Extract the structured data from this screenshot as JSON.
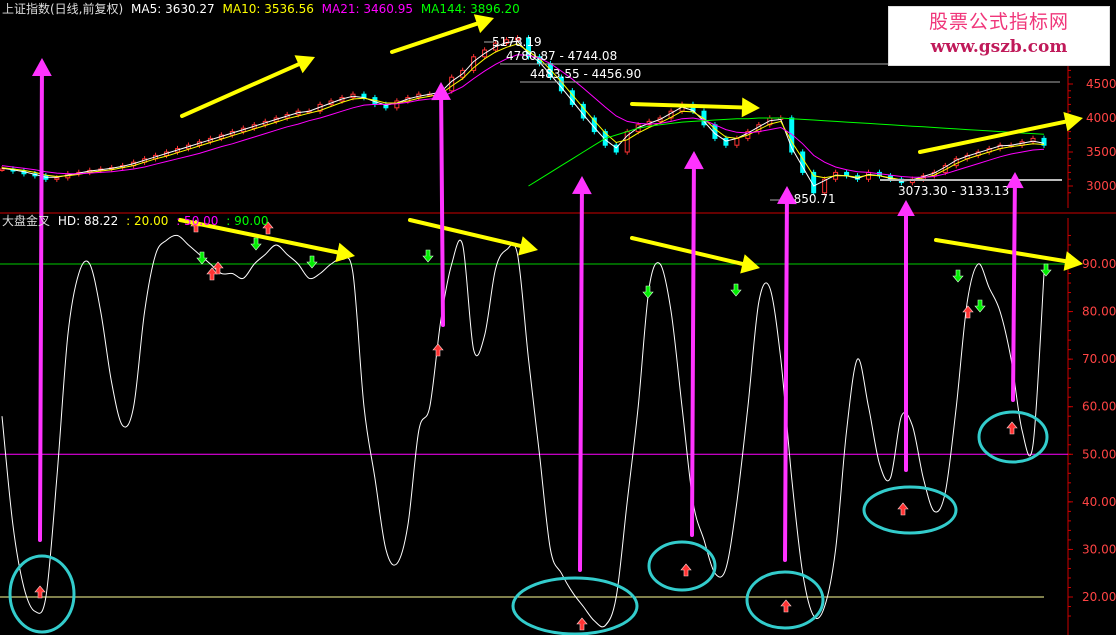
{
  "header": {
    "title": "上证指数(日线,前复权)",
    "ma5": "MA5: 3630.27",
    "ma10": "MA10: 3536.56",
    "ma21": "MA21: 3460.95",
    "ma144": "MA144: 3896.20"
  },
  "lower_header": {
    "name": "大盘金叉",
    "hd": "HD: 88.22",
    "l1": ": 20.00",
    "l2": ": 50.00",
    "l3": ": 90.00"
  },
  "watermark": {
    "line1": "股票公式指标网",
    "line2": "www.gszb.com"
  },
  "colors": {
    "ma5": "#ffffff",
    "ma10": "#ffff00",
    "ma21": "#ff00ff",
    "ma144": "#00ff00",
    "up": "#ff3333",
    "down": "#00ffff",
    "axis": "#cc0000",
    "arrow_yellow": "#ffff00",
    "arrow_magenta": "#ff33ff",
    "circle": "#33cccc"
  },
  "chart_data": [
    {
      "type": "line",
      "panel": "price",
      "title": "上证指数(日线,前复权)",
      "ylim": [
        2750,
        5600
      ],
      "yticks": [
        3000,
        3500,
        4000,
        4500
      ],
      "x": [
        0,
        3,
        6,
        9,
        12,
        15,
        18,
        21,
        24,
        27,
        30,
        33,
        36,
        39,
        42,
        45,
        48,
        51,
        54,
        57,
        60,
        63,
        66,
        69,
        72,
        75,
        78,
        81,
        84,
        87,
        90,
        93,
        96,
        99,
        102,
        105,
        108,
        111,
        114,
        117,
        120,
        123,
        126,
        129,
        132,
        135,
        138,
        141,
        144,
        147,
        150,
        153,
        156,
        159,
        162,
        165,
        168,
        171,
        174,
        177,
        180,
        183,
        186,
        189,
        192,
        195,
        198,
        201,
        204,
        207,
        210,
        213,
        216,
        219,
        222,
        225,
        228,
        231,
        234,
        237,
        240,
        243,
        246,
        249,
        252,
        255,
        258,
        261,
        264,
        267,
        270,
        273,
        276,
        279,
        282,
        285
      ],
      "series": [
        {
          "name": "上证指数",
          "values": [
            3250,
            3220,
            3180,
            3150,
            3100,
            3120,
            3180,
            3200,
            3230,
            3250,
            3270,
            3300,
            3350,
            3400,
            3450,
            3500,
            3550,
            3600,
            3650,
            3700,
            3750,
            3800,
            3850,
            3900,
            3950,
            4000,
            4050,
            4100,
            4100,
            4200,
            4250,
            4300,
            4350,
            4300,
            4200,
            4150,
            4250,
            4300,
            4350,
            4350,
            4400,
            4600,
            4700,
            4900,
            5000,
            5100,
            5150,
            5178,
            4900,
            4800,
            4600,
            4400,
            4200,
            4000,
            3800,
            3600,
            3500,
            3800,
            3900,
            3950,
            4000,
            4100,
            4200,
            4100,
            3900,
            3700,
            3600,
            3700,
            3800,
            3900,
            4000,
            4000,
            3500,
            3200,
            2900,
            3100,
            3200,
            3150,
            3100,
            3200,
            3150,
            3100,
            3050,
            3100,
            3150,
            3200,
            3300,
            3400,
            3450,
            3500,
            3550,
            3600,
            3600,
            3650,
            3700,
            3600
          ]
        },
        {
          "name": "MA5",
          "values": [
            3260,
            3240,
            3210,
            3170,
            3130,
            3130,
            3160,
            3190,
            3220,
            3240,
            3260,
            3290,
            3330,
            3380,
            3430,
            3480,
            3530,
            3580,
            3630,
            3680,
            3730,
            3780,
            3830,
            3880,
            3930,
            3980,
            4030,
            4080,
            4100,
            4160,
            4220,
            4280,
            4320,
            4300,
            4240,
            4190,
            4220,
            4280,
            4320,
            4350,
            4380,
            4540,
            4650,
            4830,
            4950,
            5050,
            5110,
            5130,
            4950,
            4820,
            4640,
            4450,
            4250,
            4050,
            3860,
            3680,
            3560,
            3740,
            3860,
            3920,
            3980,
            4070,
            4160,
            4110,
            3950,
            3770,
            3660,
            3700,
            3780,
            3870,
            3960,
            3980,
            3560,
            3280,
            3000,
            3080,
            3160,
            3150,
            3110,
            3170,
            3150,
            3110,
            3070,
            3090,
            3140,
            3190,
            3280,
            3380,
            3440,
            3490,
            3540,
            3590,
            3600,
            3630,
            3660,
            3630
          ]
        },
        {
          "name": "MA10",
          "values": [
            3270,
            3250,
            3230,
            3200,
            3160,
            3140,
            3150,
            3170,
            3200,
            3220,
            3240,
            3270,
            3300,
            3350,
            3400,
            3440,
            3490,
            3540,
            3590,
            3640,
            3690,
            3740,
            3790,
            3840,
            3890,
            3940,
            3990,
            4030,
            4070,
            4110,
            4170,
            4230,
            4280,
            4290,
            4260,
            4220,
            4220,
            4250,
            4290,
            4320,
            4350,
            4470,
            4580,
            4740,
            4870,
            4970,
            5040,
            5090,
            4980,
            4870,
            4710,
            4530,
            4340,
            4150,
            3960,
            3780,
            3640,
            3680,
            3780,
            3860,
            3930,
            4010,
            4100,
            4090,
            3990,
            3840,
            3720,
            3700,
            3750,
            3830,
            3910,
            3950,
            3650,
            3400,
            3150,
            3120,
            3150,
            3150,
            3130,
            3160,
            3150,
            3120,
            3090,
            3090,
            3120,
            3160,
            3240,
            3330,
            3400,
            3450,
            3500,
            3550,
            3580,
            3600,
            3620,
            3610
          ]
        },
        {
          "name": "MA21",
          "values": [
            3300,
            3280,
            3260,
            3240,
            3210,
            3190,
            3180,
            3180,
            3190,
            3200,
            3210,
            3230,
            3250,
            3280,
            3320,
            3360,
            3400,
            3440,
            3480,
            3530,
            3580,
            3620,
            3670,
            3720,
            3770,
            3820,
            3870,
            3910,
            3960,
            4000,
            4050,
            4100,
            4150,
            4190,
            4200,
            4200,
            4210,
            4230,
            4260,
            4280,
            4300,
            4380,
            4460,
            4580,
            4690,
            4790,
            4870,
            4930,
            4920,
            4880,
            4800,
            4690,
            4570,
            4440,
            4300,
            4160,
            4030,
            3950,
            3920,
            3910,
            3920,
            3950,
            3990,
            4000,
            3970,
            3900,
            3830,
            3790,
            3780,
            3800,
            3830,
            3860,
            3760,
            3620,
            3450,
            3350,
            3280,
            3240,
            3210,
            3200,
            3180,
            3160,
            3140,
            3130,
            3130,
            3140,
            3180,
            3230,
            3280,
            3330,
            3380,
            3430,
            3470,
            3500,
            3530,
            3540
          ]
        },
        {
          "name": "MA144",
          "values": [
            null,
            null,
            null,
            null,
            null,
            null,
            null,
            null,
            null,
            null,
            null,
            null,
            null,
            null,
            null,
            null,
            null,
            null,
            null,
            null,
            null,
            null,
            null,
            null,
            null,
            null,
            null,
            null,
            null,
            null,
            null,
            null,
            null,
            null,
            null,
            null,
            null,
            null,
            null,
            null,
            null,
            null,
            null,
            null,
            null,
            null,
            null,
            null,
            3000,
            3100,
            3200,
            3300,
            3400,
            3500,
            3600,
            3700,
            3750,
            3800,
            3850,
            3880,
            3900,
            3920,
            3940,
            3950,
            3960,
            3970,
            3980,
            3990,
            3990,
            4000,
            4000,
            4000,
            3990,
            3980,
            3970,
            3960,
            3950,
            3940,
            3930,
            3920,
            3910,
            3900,
            3890,
            3880,
            3870,
            3860,
            3850,
            3840,
            3830,
            3820,
            3810,
            3800,
            3790,
            3780,
            3770,
            3760
          ]
        }
      ],
      "annotations": [
        "5178.19",
        "4780.87 - 4744.08",
        "4483.55 - 4456.90",
        "2850.71",
        "3073.30 - 3133.13"
      ]
    },
    {
      "type": "line",
      "panel": "indicator",
      "title": "大盘金叉",
      "ylim": [
        14,
        98
      ],
      "yticks": [
        20,
        30,
        40,
        50,
        60,
        70,
        80,
        90
      ],
      "hlines": [
        20,
        50,
        90
      ],
      "x": [
        0,
        3,
        6,
        9,
        12,
        15,
        18,
        21,
        24,
        27,
        30,
        33,
        36,
        39,
        42,
        45,
        48,
        51,
        54,
        57,
        60,
        63,
        66,
        69,
        72,
        75,
        78,
        81,
        84,
        87,
        90,
        93,
        96,
        99,
        102,
        105,
        108,
        111,
        114,
        117,
        120,
        123,
        126,
        129,
        132,
        135,
        138,
        141,
        144,
        147,
        150,
        153,
        156,
        159,
        162,
        165,
        168,
        171,
        174,
        177,
        180,
        183,
        186,
        189,
        192,
        195,
        198,
        201,
        204,
        207,
        210,
        213,
        216,
        219,
        222,
        225,
        228,
        231,
        234,
        237,
        240,
        243,
        246,
        249,
        252,
        255,
        258,
        261,
        264,
        267,
        270,
        273,
        276,
        279,
        282,
        285
      ],
      "series": [
        {
          "name": "HD",
          "values": [
            58,
            35,
            22,
            17,
            20,
            45,
            75,
            88,
            90,
            80,
            65,
            56,
            60,
            80,
            92,
            95,
            96,
            94,
            92,
            90,
            88,
            88,
            87,
            90,
            92,
            94,
            92,
            90,
            87,
            88,
            90,
            91,
            88,
            60,
            45,
            30,
            27,
            35,
            55,
            60,
            78,
            90,
            94,
            72,
            75,
            89,
            93,
            92,
            70,
            50,
            30,
            25,
            21,
            18,
            15,
            14,
            20,
            40,
            60,
            85,
            90,
            80,
            60,
            40,
            32,
            25,
            26,
            40,
            60,
            82,
            85,
            70,
            45,
            25,
            16,
            18,
            30,
            55,
            70,
            60,
            48,
            45,
            58,
            56,
            45,
            38,
            42,
            60,
            82,
            90,
            85,
            80,
            70,
            55,
            52,
            88
          ]
        }
      ]
    }
  ]
}
